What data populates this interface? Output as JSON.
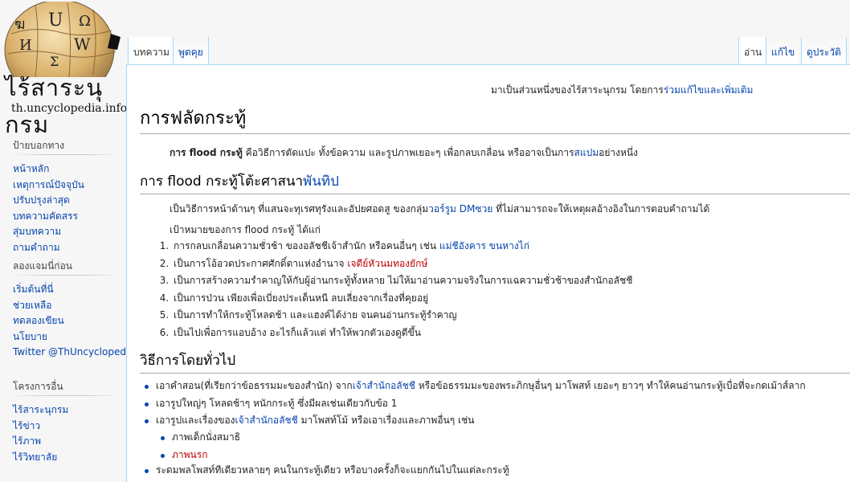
{
  "logo": {
    "wordmark": "ไร้สาระนุกรม",
    "domain": "th.uncyclopedia.info",
    "puzzle_glyphs": [
      "ฆ",
      "U",
      "Ω",
      "И",
      "W",
      "Ʃ"
    ]
  },
  "sidebar": {
    "sections": [
      {
        "heading": "ป้ายบอกทาง",
        "items": [
          "หน้าหลัก",
          "เหตุการณ์ปัจจุบัน",
          "ปรับปรุงล่าสุด",
          "บทความคัดสรร",
          "สุ่มบทความ",
          "ถามคำถาม"
        ]
      },
      {
        "heading": "ลองแจมนี่ก่อน",
        "items": [
          "เริ่มต้นที่นี่",
          "ช่วยเหลือ",
          "ทดลองเขียน",
          "นโยบาย",
          "Twitter @ThUncyclopedia"
        ]
      },
      {
        "heading": "โครงการอื่น",
        "items": [
          "ไร้สาระนุกรม",
          "ไร้ข่าว",
          "ไร้ภาพ",
          "ไร้วิทยาลัย"
        ]
      }
    ]
  },
  "tabs": {
    "left": [
      {
        "label": "บทความ",
        "selected": true
      },
      {
        "label": "พูดคุย",
        "selected": false
      }
    ],
    "right": [
      {
        "label": "อ่าน",
        "selected": true
      },
      {
        "label": "แก้ไข",
        "selected": false
      },
      {
        "label": "ดูประวัติ",
        "selected": false
      }
    ]
  },
  "sitenotice": {
    "prefix": "มาเป็นส่วนหนึ่งของไร้สาระนุกรม โดยการ",
    "link": "ร่วมแก้ไขและเพิ่มเติม"
  },
  "page_title": "การฟลัดกระทู้",
  "intro": {
    "bold": "การ flood กระทู้",
    "text": " คือวิธีการตัดแปะ ทั้งข้อความ และรูปภาพเยอะๆ เพื่อกลบเกลื่อน หรืออาจเป็นการ",
    "link": "สแปม",
    "suffix": "อย่างหนึ่ง"
  },
  "section1": {
    "heading_text": "การ flood กระทู้โต้ะศาสนา",
    "heading_link": "พันทิป",
    "p1_prefix": "เป็นวิธีการหน้าด้านๆ ที่แสนจะทุเรศทุรังและอัปยศอดสู ของกลุ่ม",
    "p1_link": "วอร์รูม DMซวย",
    "p1_suffix": " ที่ไม่สามารถจะให้เหตุผลอ้างอิงในการตอบคำถามได้",
    "p2": "เป้าหมายของการ flood กระทู้ ได้แก่",
    "goals": [
      {
        "text": "การกลบเกลื่อนความชั่วช้า ของอลัชชีเจ้าสำนัก หรือคนอื่นๆ เช่น ",
        "link": "แม่ชีอังคาร ขนหางไก่",
        "link_red": false
      },
      {
        "text": "เป็นการโอ้อวดประกาศศักดิ์ดาแห่งอำนาจ ",
        "link": "เจดีย์หัวนมทองยักษ์",
        "link_red": true
      },
      {
        "text": "เป็นการสร้างความรำคาญให้กับผู้อ่านกระทู้ทั้งหลาย ไม่ให้มาอ่านความจริงในการแฉความชั่วช้าของสำนักอลัชชี",
        "link": "",
        "link_red": false
      },
      {
        "text": "เป็นการป่วน เพียงเพื่อเบี่ยงประเด็นหนี ลบเลี่ยงจากเรื่องที่คุยอยู่",
        "link": "",
        "link_red": false
      },
      {
        "text": "เป็นการทำให้กระทู้โหลดช้า และแฮงค์ได้ง่าย จนคนอ่านกระทู้รำคาญ",
        "link": "",
        "link_red": false
      },
      {
        "text": "เป็นไปเพื่อการแอบอ้าง อะไรก็แล้วแต่ ทำให้พวกตัวเองดูดีขึ้น",
        "link": "",
        "link_red": false
      }
    ]
  },
  "section2": {
    "heading": "วิธีการโดยทั่วไป",
    "b1_prefix": "เอาคำสอน(ที่เรียกว่าข้อธรรมมะของสำนัก) จาก",
    "b1_link": "เจ้าสำนักอลัชชี",
    "b1_suffix": " หรือข้อธรรมมะของพระภิกษุอื่นๆ มาโพสท์ เยอะๆ ยาวๆ ทำให้คนอ่านกระทู้เบื่อที่จะกดเม้าส์ลาก",
    "b2": "เอารูปใหญ่ๆ โหลดช้าๆ หนักกระทู้ ซึ่งมีผลเช่นเดียวกับข้อ 1",
    "b3_prefix": "เอารูปและเรื่องของ",
    "b3_link": "เจ้าสำนักอลัชชี",
    "b3_suffix": " มาโพสท์โม้ หรือเอาเรื่องและภาพอื่นๆ เช่น",
    "sub1": "ภาพเด็กนั่งสมาธิ",
    "sub2": "ภาพนรก",
    "b4": "ระดมพลโพสท์ทีเดียวหลายๆ คนในกระทู้เดียว หรือบางครั้งก็จะแยกกันไปในแต่ละกระทู้"
  },
  "colors": {
    "link": "#0645ad",
    "redlink": "#ba0000",
    "tab_border": "#a7d7f9"
  }
}
